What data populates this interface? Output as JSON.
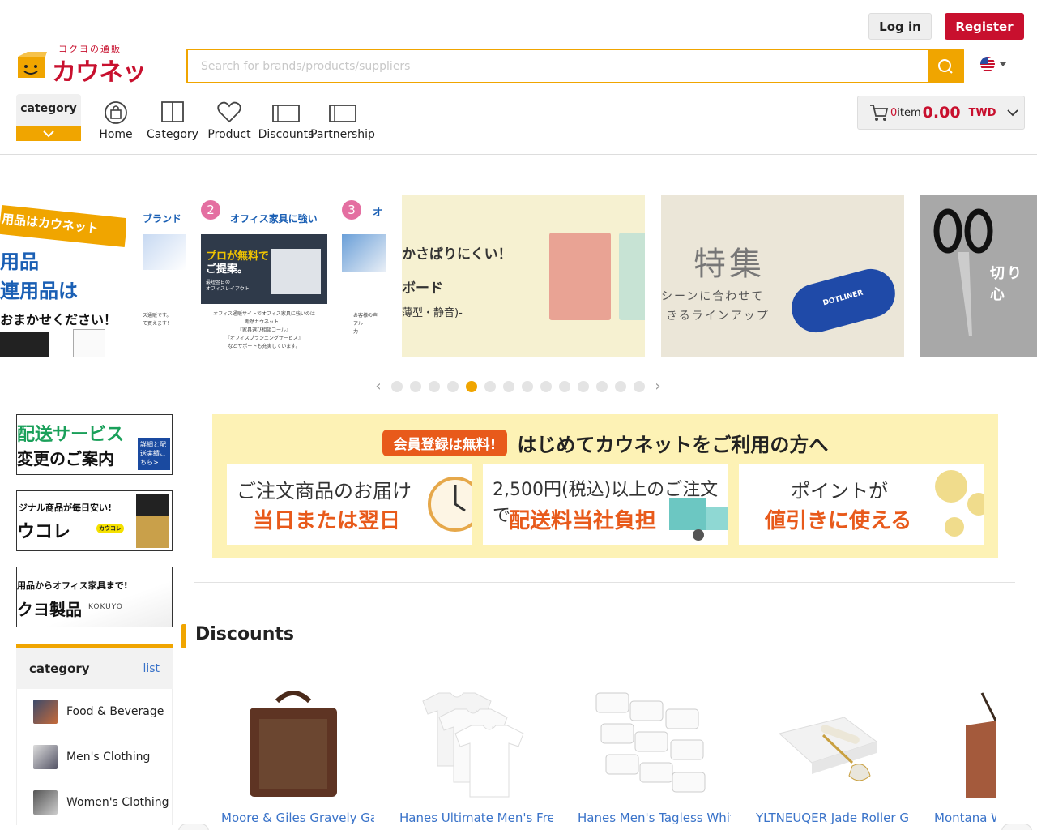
{
  "header": {
    "login_label": "Log in",
    "register_label": "Register",
    "logo_sub": "コクヨの通販",
    "logo_main": "カウネット",
    "search_placeholder": "Search for brands/products/suppliers",
    "search_value": ""
  },
  "nav": {
    "category_button": "category",
    "items": [
      {
        "label": "Home",
        "icon": "shopping-bag-icon"
      },
      {
        "label": "Category",
        "icon": "book-icon"
      },
      {
        "label": "Product",
        "icon": "heart-icon"
      },
      {
        "label": "Discounts",
        "icon": "box-icon"
      },
      {
        "label": "Partnership",
        "icon": "box-icon"
      }
    ]
  },
  "cart": {
    "count": "0",
    "item_label": "item",
    "amount": "0.00",
    "currency": "TWD"
  },
  "carousel": {
    "slides": [
      {
        "lines": [
          "用品はカウネット",
          "用品",
          "連用品は",
          "おまかせください！"
        ]
      },
      {
        "lines": [
          "ブランド",
          "2",
          "オフィス家具に強い",
          "3",
          "オ",
          "プロが無料で",
          "ご提案。",
          "最短翌日の",
          "オフィスレイアウト",
          "オフィス通販サイトでオフィス家具に強いのは",
          "断然カウネット！",
          "『家具選び相談コール』",
          "『オフィスプランニングサービス』",
          "などサポートも充実しています。",
          "ス通販です。",
          "て買えます！",
          "お客様の声",
          "アル",
          "力"
        ]
      },
      {
        "lines": [
          "かさばりにくい！",
          "ボード",
          "薄型・静音)-"
        ]
      },
      {
        "lines": [
          "特集",
          "シーンに合わせて",
          "きるラインアップ",
          "DOTLINER"
        ]
      },
      {
        "lines": [
          "切り心"
        ]
      }
    ],
    "dot_count": 14,
    "active_index": 4
  },
  "side_banners": [
    {
      "line1": "配送サービス",
      "line2": "変更のご案内",
      "tag": "詳細と配送実績こちら>"
    },
    {
      "line1": "ジナル商品が毎日安い!",
      "line2": "ウコレ",
      "tag": "カウコレ"
    },
    {
      "line1": "用品からオフィス家具まで!",
      "line2": "クヨ製品",
      "tag": "KOKUYO"
    }
  ],
  "category_panel": {
    "title": "category",
    "list_link": "list",
    "items": [
      "Food & Beverage",
      "Men's Clothing",
      "Women's Clothing"
    ]
  },
  "promo": {
    "badge": "会員登録は無料!",
    "title": "はじめてカウネットをご利用の方へ",
    "cards": [
      {
        "line1": "ご注文商品のお届け",
        "line2": "当日または翌日"
      },
      {
        "line1": "2,500円(税込)以上のご注文で",
        "line2": "配送料当社負担"
      },
      {
        "line1": "ポイントが",
        "line2": "値引きに使える"
      }
    ]
  },
  "discounts": {
    "title": "Discounts",
    "products": [
      {
        "title": "Moore & Giles Gravely Garment Bag Ventile Olive"
      },
      {
        "title": "Hanes Ultimate Men's Fresh IQ Slim Fit Crew Undershirt"
      },
      {
        "title": "Hanes Men's Tagless White Briefs with ComfortFlex"
      },
      {
        "title": "YLTNEUQER Jade Roller Gua Sha Set - Facial Skin Care"
      },
      {
        "title": "Montana West Purse and Handbag"
      }
    ]
  },
  "colors": {
    "accent": "#f0a500",
    "brand": "#c8102e",
    "link": "#3a73c9",
    "promo_bg": "#fdf2b5",
    "promo_orange": "#e85a1b"
  }
}
